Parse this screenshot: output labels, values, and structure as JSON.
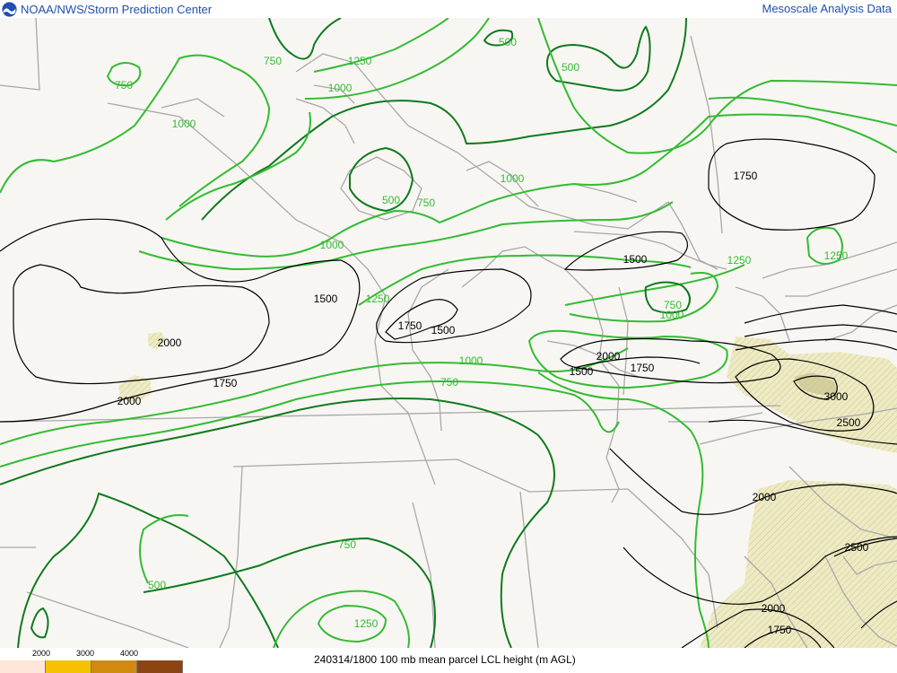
{
  "header": {
    "title": "NOAA/NWS/Storm Prediction Center",
    "right_title": "Mesoscale Analysis Data"
  },
  "caption": "240314/1800 100 mb mean parcel LCL height (m AGL)",
  "legend": {
    "labels": [
      "2000",
      "3000",
      "4000"
    ],
    "colors": [
      "#fde6d8",
      "#f6c200",
      "#d08a10",
      "#8b4513"
    ]
  },
  "colors": {
    "background": "#f8f6f2",
    "borders": "#a8a8a8",
    "contour_green_light": "#33bb33",
    "contour_green_dark": "#0f7a1f",
    "contour_black": "#000000",
    "hatch_fill": "#eeebc4"
  },
  "map_labels": {
    "g500_a": "500",
    "g500_b": "500",
    "g500_c": "500",
    "g500_d": "500",
    "g750_a": "750",
    "g750_b": "750",
    "g750_c": "750",
    "g750_d": "750",
    "g750_e": "750",
    "g750_f": "750",
    "g1000_a": "1000",
    "g1000_b": "1000",
    "g1000_c": "1000",
    "g1000_d": "1000",
    "g1000_e": "1000",
    "g1000_f": "1000",
    "g1250_a": "1250",
    "g1250_b": "1250",
    "g1250_c": "1250",
    "g1250_d": "1250",
    "g1250_e": "1250",
    "k1500_a": "1500",
    "k1500_b": "1500",
    "k1500_c": "1500",
    "k1500_d": "1500",
    "k1750_a": "1750",
    "k1750_b": "1750",
    "k1750_c": "1750",
    "k1750_d": "1750",
    "k1750_e": "1750",
    "k2000_a": "2000",
    "k2000_b": "2000",
    "k2000_c": "2000",
    "k2000_d": "2000",
    "k2000_e": "2000",
    "k2500_a": "2500",
    "k2500_b": "2500",
    "k3000_a": "3000"
  }
}
